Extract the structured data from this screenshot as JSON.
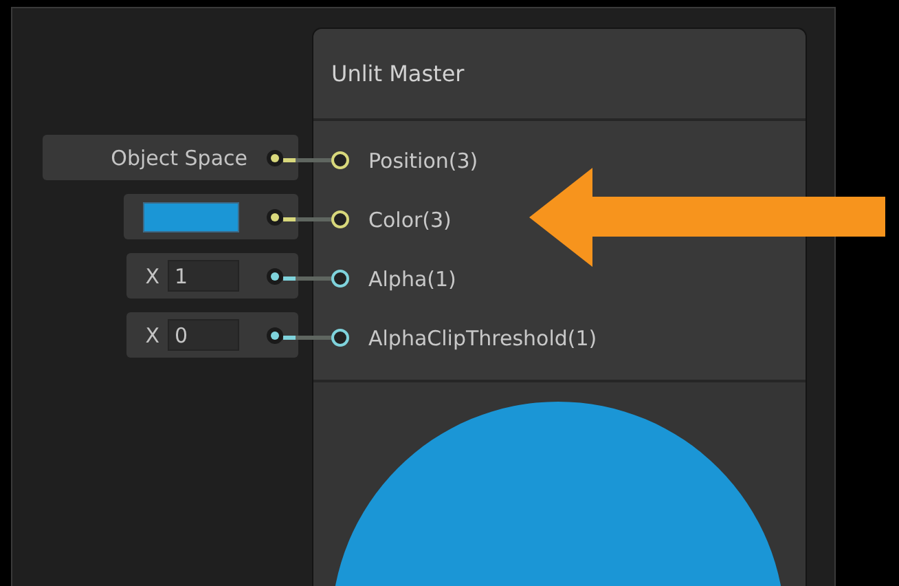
{
  "node": {
    "title": "Unlit Master",
    "ports": [
      {
        "label": "Position(3)",
        "color": "#d8d87c",
        "input": {
          "kind": "dropdown",
          "value": "Object Space"
        }
      },
      {
        "label": "Color(3)",
        "color": "#d8d87c",
        "input": {
          "kind": "color",
          "color": "#1b96d6"
        }
      },
      {
        "label": "Alpha(1)",
        "color": "#7fd3dc",
        "input": {
          "kind": "float",
          "axis": "X",
          "value": "1"
        }
      },
      {
        "label": "AlphaClipThreshold(1)",
        "color": "#7fd3dc",
        "input": {
          "kind": "float",
          "axis": "X",
          "value": "0"
        }
      }
    ]
  }
}
